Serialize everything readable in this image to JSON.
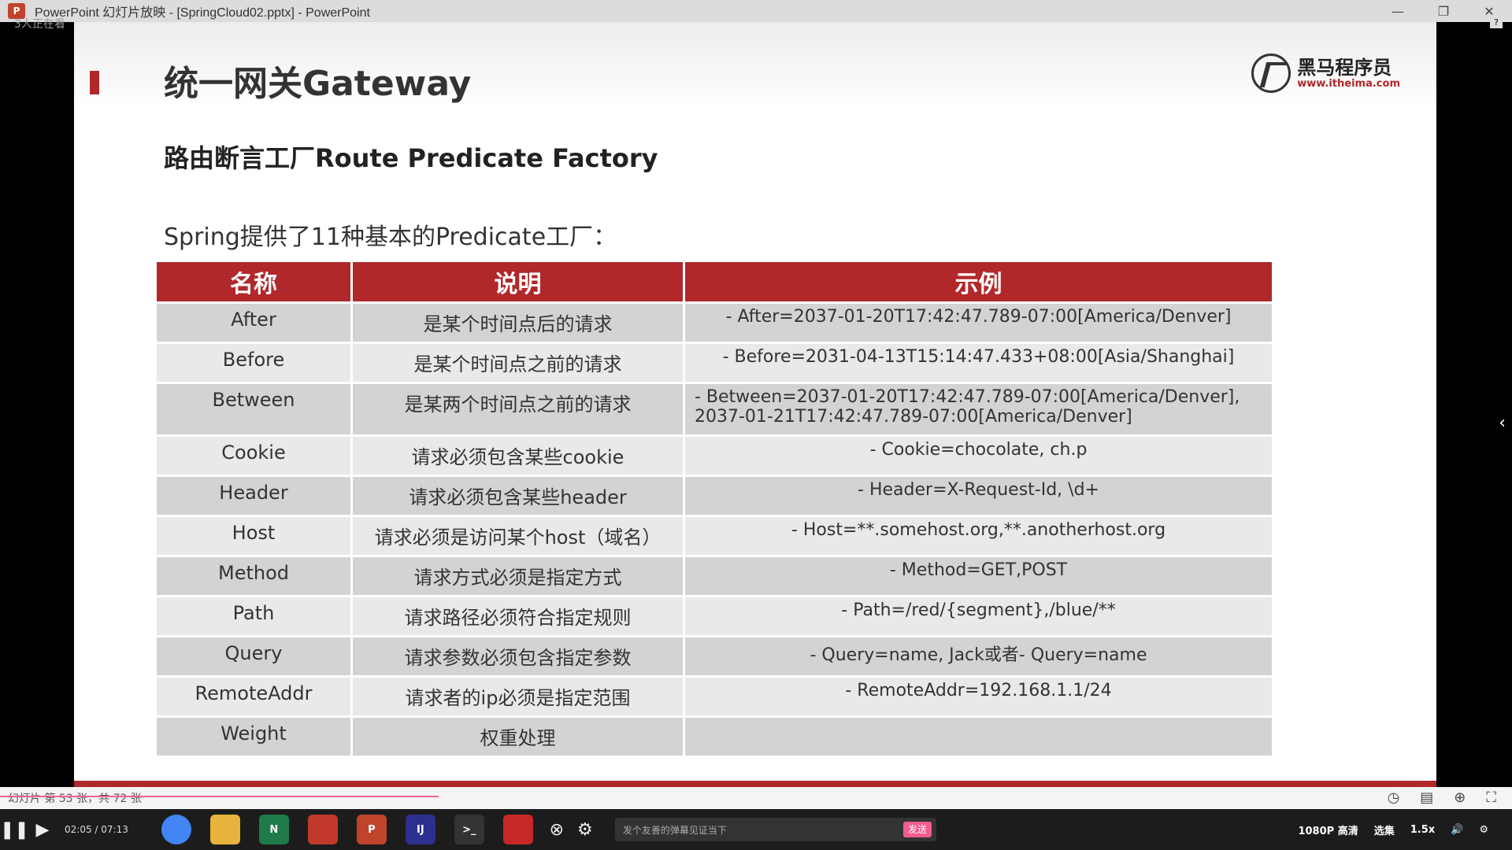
{
  "window": {
    "title": "PowerPoint 幻灯片放映 - [SpringCloud02.pptx] - PowerPoint",
    "app_icon_letter": "P",
    "minimize": "—",
    "restore": "❐",
    "close": "✕",
    "watermark_top": "3人正在看"
  },
  "slide": {
    "title": "统一网关Gateway",
    "logo_name": "黑马程序员",
    "logo_url": "www.itheima.com",
    "subtitle": "路由断言工厂Route Predicate Factory",
    "intro": "Spring提供了11种基本的Predicate工厂：",
    "table": {
      "headers": [
        "名称",
        "说明",
        "示例"
      ],
      "rows": [
        {
          "name": "After",
          "desc": "是某个时间点后的请求",
          "example": "- After=2037-01-20T17:42:47.789-07:00[America/Denver]"
        },
        {
          "name": "Before",
          "desc": "是某个时间点之前的请求",
          "example": "- Before=2031-04-13T15:14:47.433+08:00[Asia/Shanghai]"
        },
        {
          "name": "Between",
          "desc": "是某两个时间点之前的请求",
          "example": "- Between=2037-01-20T17:42:47.789-07:00[America/Denver], 2037-01-21T17:42:47.789-07:00[America/Denver]"
        },
        {
          "name": "Cookie",
          "desc": "请求必须包含某些cookie",
          "example": "- Cookie=chocolate, ch.p"
        },
        {
          "name": "Header",
          "desc": "请求必须包含某些header",
          "example": "- Header=X-Request-Id, \\d+"
        },
        {
          "name": "Host",
          "desc": "请求必须是访问某个host（域名）",
          "example": "- Host=**.somehost.org,**.anotherhost.org"
        },
        {
          "name": "Method",
          "desc": "请求方式必须是指定方式",
          "example": "- Method=GET,POST"
        },
        {
          "name": "Path",
          "desc": "请求路径必须符合指定规则",
          "example": "- Path=/red/{segment},/blue/**"
        },
        {
          "name": "Query",
          "desc": "请求参数必须包含指定参数",
          "example": "- Query=name, Jack或者- Query=name"
        },
        {
          "name": "RemoteAddr",
          "desc": "请求者的ip必须是指定范围",
          "example": "- RemoteAddr=192.168.1.1/24"
        },
        {
          "name": "Weight",
          "desc": "权重处理",
          "example": ""
        }
      ]
    }
  },
  "status": {
    "slide_counter": "幻灯片 第 53 张，共 72 张",
    "progress": 0.29
  },
  "player": {
    "time_current": "02:05",
    "time_total": "07:13",
    "danmu_placeholder": "发个友善的弹幕见证当下",
    "send_label": "发送",
    "quality": "1080P 高清",
    "episodes": "选集",
    "speed": "1.5x"
  },
  "colors": {
    "accent_red": "#b0282a",
    "row_dark": "#d3d3d3",
    "row_light": "#e9e9e9"
  }
}
